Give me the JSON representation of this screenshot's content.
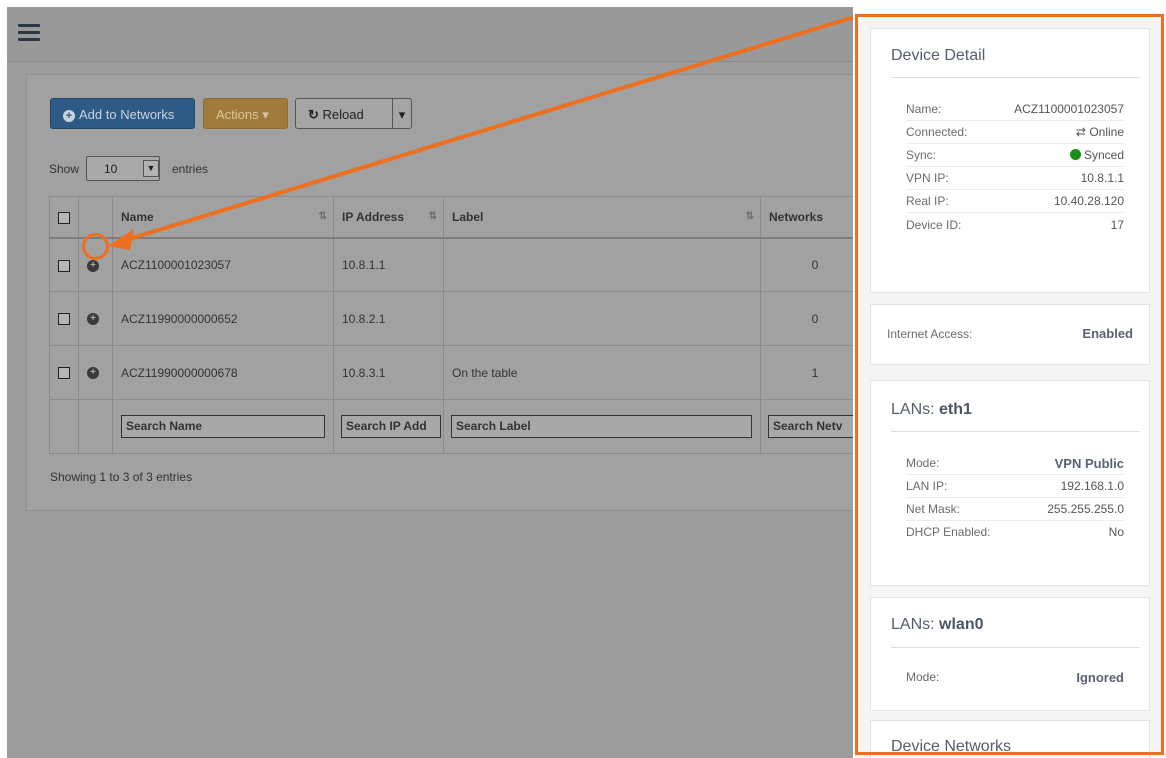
{
  "toolbar": {
    "add_label": "Add to Networks",
    "actions_label": "Actions",
    "reload_label": "Reload"
  },
  "length_menu": {
    "show_label": "Show",
    "selected": "10",
    "entries_label": "entries"
  },
  "table": {
    "columns": [
      "Name",
      "IP Address",
      "Label",
      "Networks"
    ],
    "rows": [
      {
        "name": "ACZ1100001023057",
        "ip": "10.8.1.1",
        "label": "",
        "networks": "0"
      },
      {
        "name": "ACZ11990000000652",
        "ip": "10.8.2.1",
        "label": "",
        "networks": "0"
      },
      {
        "name": "ACZ11990000000678",
        "ip": "10.8.3.1",
        "label": "On the table",
        "networks": "1"
      }
    ],
    "search_placeholders": {
      "name": "Search Name",
      "ip": "Search IP Add",
      "label": "Search Label",
      "networks": "Search Netv"
    },
    "info": "Showing 1 to 3 of 3 entries"
  },
  "detail": {
    "title": "Device Detail",
    "items": [
      {
        "k": "Name:",
        "v": "ACZ1100001023057"
      },
      {
        "k": "Connected:",
        "v": "Online"
      },
      {
        "k": "Sync:",
        "v": "Synced"
      },
      {
        "k": "VPN IP:",
        "v": "10.8.1.1"
      },
      {
        "k": "Real IP:",
        "v": "10.40.28.120"
      },
      {
        "k": "Device ID:",
        "v": "17"
      }
    ]
  },
  "internet": {
    "k": "Internet Access:",
    "v": "Enabled"
  },
  "lan_eth1": {
    "title_prefix": "LANs:",
    "iface": "eth1",
    "items": [
      {
        "k": "Mode:",
        "v": "VPN Public"
      },
      {
        "k": "LAN IP:",
        "v": "192.168.1.0"
      },
      {
        "k": "Net Mask:",
        "v": "255.255.255.0"
      },
      {
        "k": "DHCP Enabled:",
        "v": "No"
      }
    ]
  },
  "lan_wlan0": {
    "title_prefix": "LANs:",
    "iface": "wlan0",
    "items": [
      {
        "k": "Mode:",
        "v": "Ignored"
      }
    ]
  },
  "networks_box": {
    "title": "Device Networks"
  },
  "colors": {
    "highlight": "#ee6f1d",
    "online": "#28b87a",
    "synced_dot": "#1a8f1a"
  }
}
